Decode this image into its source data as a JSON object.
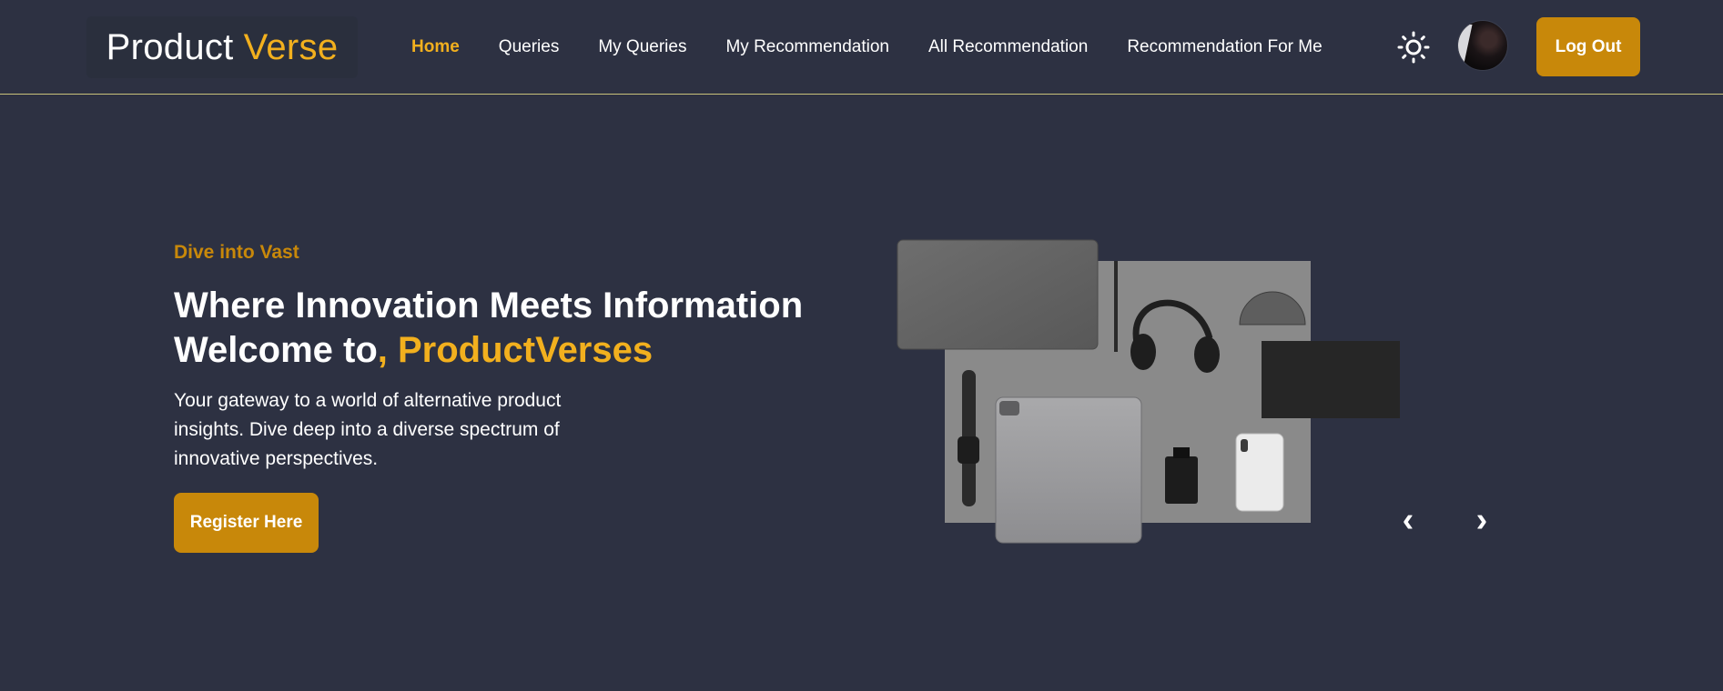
{
  "brand": {
    "word1": "Product",
    "word2": "Verse"
  },
  "nav": {
    "links": [
      {
        "label": "Home"
      },
      {
        "label": "Queries"
      },
      {
        "label": "My Queries"
      },
      {
        "label": "My Recommendation"
      },
      {
        "label": "All Recommendation"
      },
      {
        "label": "Recommendation For Me"
      }
    ],
    "active_index": 0,
    "logout_label": "Log Out",
    "theme_icon": "sun-icon"
  },
  "hero": {
    "eyebrow": "Dive into Vast",
    "headline_line1": "Where Innovation Meets Information",
    "headline_line2_prefix": "Welcome to",
    "headline_line2_accent": ", ProductVerses",
    "description": "Your gateway to a world of alternative product insights. Dive deep into a diverse spectrum of innovative perspectives.",
    "cta_label": "Register Here"
  },
  "carousel": {
    "prev_label": "‹",
    "next_label": "›"
  },
  "colors": {
    "background": "#2d3142",
    "accent": "#f2b01e",
    "button": "#c8880a",
    "nav_border": "#c9c27a"
  }
}
